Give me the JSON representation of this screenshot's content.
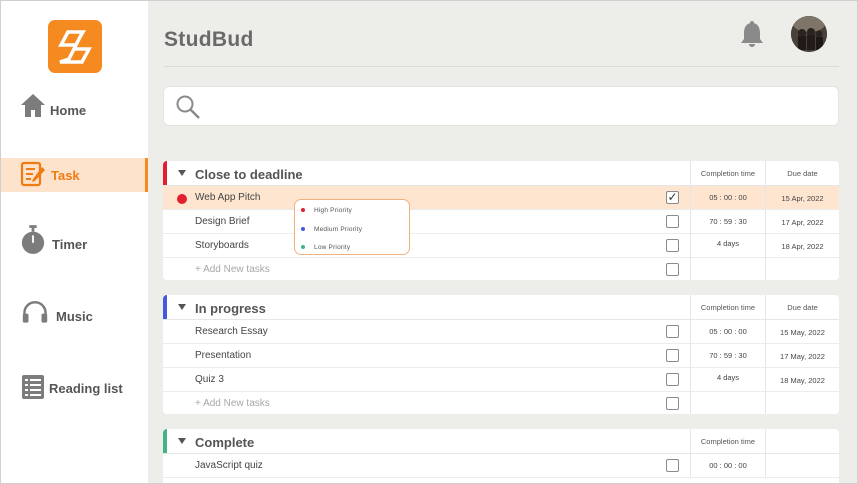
{
  "app": {
    "title": "StudBud"
  },
  "sidebar": {
    "items": [
      {
        "label": "Home",
        "icon": "home-icon"
      },
      {
        "label": "Task",
        "icon": "task-icon",
        "active": true
      },
      {
        "label": "Timer",
        "icon": "stopwatch-icon"
      },
      {
        "label": "Music",
        "icon": "headphones-icon"
      },
      {
        "label": "Reading list",
        "icon": "reading-list-icon"
      }
    ]
  },
  "colors": {
    "brand": "#f58a21",
    "active_bg": "#fde3cc",
    "deadline": "#e2202e",
    "in_progress": "#4559e0",
    "complete": "#44b38a",
    "high": "#e2202e",
    "medium": "#4559e0",
    "low": "#44b38a"
  },
  "search": {
    "placeholder": ""
  },
  "groups": [
    {
      "title": "Close to deadline",
      "col_completion": "Completion time",
      "col_due": "Due date",
      "tasks": [
        {
          "name": "Web App Pitch",
          "completion": "05 : 00 : 00",
          "due": "15 Apr, 2022",
          "checked": true,
          "highlighted": true,
          "priority": "High"
        },
        {
          "name": "Design Brief",
          "completion": "70 : 59 : 30",
          "due": "17 Apr, 2022",
          "checked": false
        },
        {
          "name": "Storyboards",
          "completion": "4 days",
          "due": "18 Apr, 2022",
          "checked": false
        }
      ],
      "add_label": "+ Add New tasks"
    },
    {
      "title": "In progress",
      "col_completion": "Completion time",
      "col_due": "Due date",
      "tasks": [
        {
          "name": "Research Essay",
          "completion": "05 : 00 : 00",
          "due": "15 May, 2022",
          "checked": false
        },
        {
          "name": "Presentation",
          "completion": "70 : 59 : 30",
          "due": "17 May, 2022",
          "checked": false
        },
        {
          "name": "Quiz 3",
          "completion": "4 days",
          "due": "18 May, 2022",
          "checked": false
        }
      ],
      "add_label": "+ Add New tasks"
    },
    {
      "title": "Complete",
      "col_completion": "Completion time",
      "col_due": "",
      "tasks": [
        {
          "name": "JavaScript quiz",
          "completion": "00 : 00 : 00",
          "due": "",
          "checked": false
        }
      ]
    }
  ],
  "priority_menu": {
    "options": [
      {
        "label": "High Priority"
      },
      {
        "label": "Medium Priority"
      },
      {
        "label": "Low Priority"
      }
    ]
  }
}
